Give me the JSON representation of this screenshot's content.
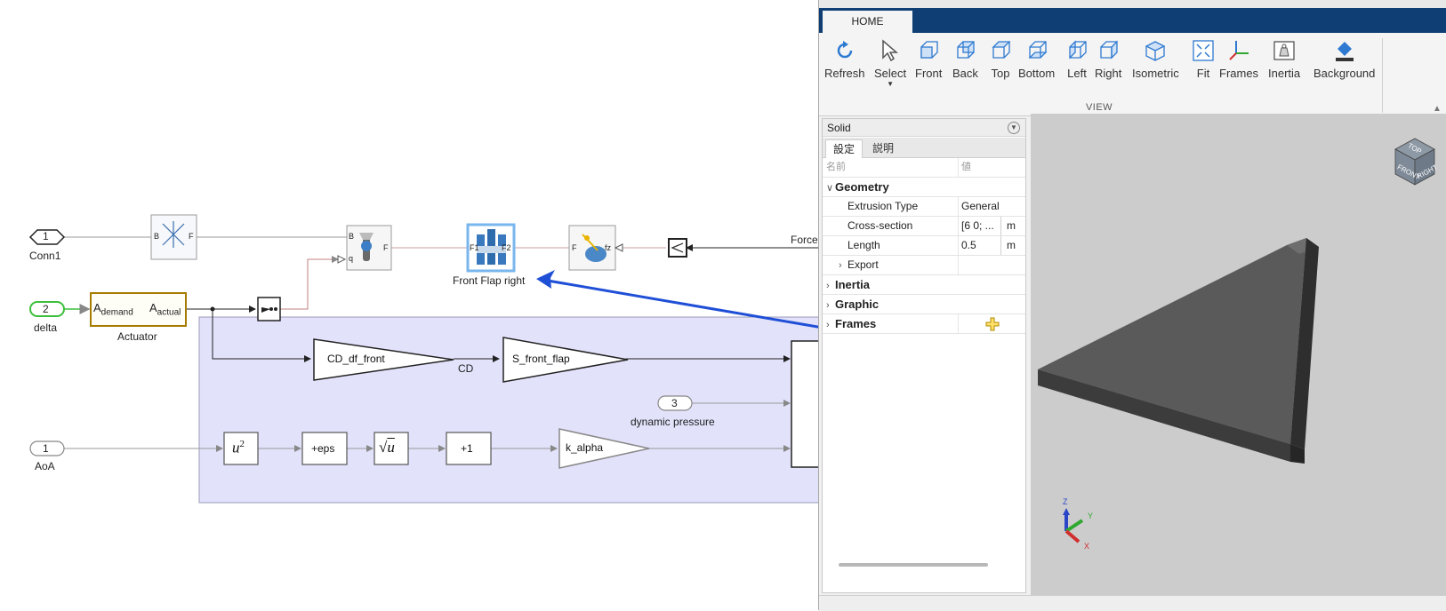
{
  "diagram": {
    "conn1_port_number": "1",
    "conn1_label": "Conn1",
    "delta_port_number": "2",
    "delta_label": "delta",
    "aoa_port_number": "1",
    "aoa_label": "AoA",
    "dyn_port_number": "3",
    "dyn_label": "dynamic pressure",
    "actuator_label": "Actuator",
    "actuator_in_prefix": "A",
    "actuator_in_sub": "demand",
    "actuator_out_prefix": "A",
    "actuator_out_sub": "actual",
    "transform_port_b": "B",
    "transform_port_f": "F",
    "joint_port_b": "B",
    "joint_port_f": "F",
    "joint_port_q": "q",
    "solid_port_f1": "F1",
    "solid_port_f2": "F2",
    "solid_label": "Front Flap right",
    "force_port_f": "F",
    "force_port_fz": "fz",
    "force_signal_label": "Force",
    "gain_cd": "CD_df_front",
    "cd_signal_label": "CD",
    "gain_s": "S_front_flap",
    "gain_k": "k_alpha",
    "fn_square": "u",
    "fn_square_exp": "2",
    "fn_eps": "+eps",
    "fn_sqrt": "u",
    "fn_plus1": "+1"
  },
  "mechanics": {
    "tab_home": "HOME",
    "ribbon_buttons": [
      {
        "label": "Refresh",
        "icon": "refresh-icon"
      },
      {
        "label": "Select",
        "icon": "select-icon"
      },
      {
        "label": "Front",
        "icon": "front-view-icon"
      },
      {
        "label": "Back",
        "icon": "back-view-icon"
      },
      {
        "label": "Top",
        "icon": "top-view-icon"
      },
      {
        "label": "Bottom",
        "icon": "bottom-view-icon"
      },
      {
        "label": "Left",
        "icon": "left-view-icon"
      },
      {
        "label": "Right",
        "icon": "right-view-icon"
      },
      {
        "label": "Isometric",
        "icon": "isometric-view-icon"
      },
      {
        "label": "Fit",
        "icon": "fit-icon"
      },
      {
        "label": "Frames",
        "icon": "frames-icon"
      },
      {
        "label": "Inertia",
        "icon": "inertia-icon"
      },
      {
        "label": "Background",
        "icon": "background-icon"
      }
    ],
    "view_group_label": "VIEW",
    "panel_title": "Solid",
    "tab_settings": "設定",
    "tab_description": "説明",
    "col_name": "名前",
    "col_value": "値",
    "geometry_label": "Geometry",
    "extrusion_type_label": "Extrusion Type",
    "extrusion_type_value": "General",
    "cross_section_label": "Cross-section",
    "cross_section_value": "[6 0; ...",
    "cross_section_unit": "m",
    "length_label": "Length",
    "length_value": "0.5",
    "length_unit": "m",
    "export_label": "Export",
    "inertia_label": "Inertia",
    "graphic_label": "Graphic",
    "frames_label": "Frames",
    "cube_top": "TOP",
    "cube_front": "FRONT",
    "cube_right": "RIGHT",
    "axis_z": "Z",
    "axis_y": "Y",
    "axis_x": "X"
  },
  "colors": {
    "subsystem_fill": "#e2e2fb",
    "arrow": "#1f4fd6",
    "accent_dark": "#0f3e74",
    "inport_green": "#3cbf3c",
    "actuator_border": "#a67c00",
    "solid_highlight": "#79b6ee",
    "flap_shape": "#5a5a5a"
  }
}
